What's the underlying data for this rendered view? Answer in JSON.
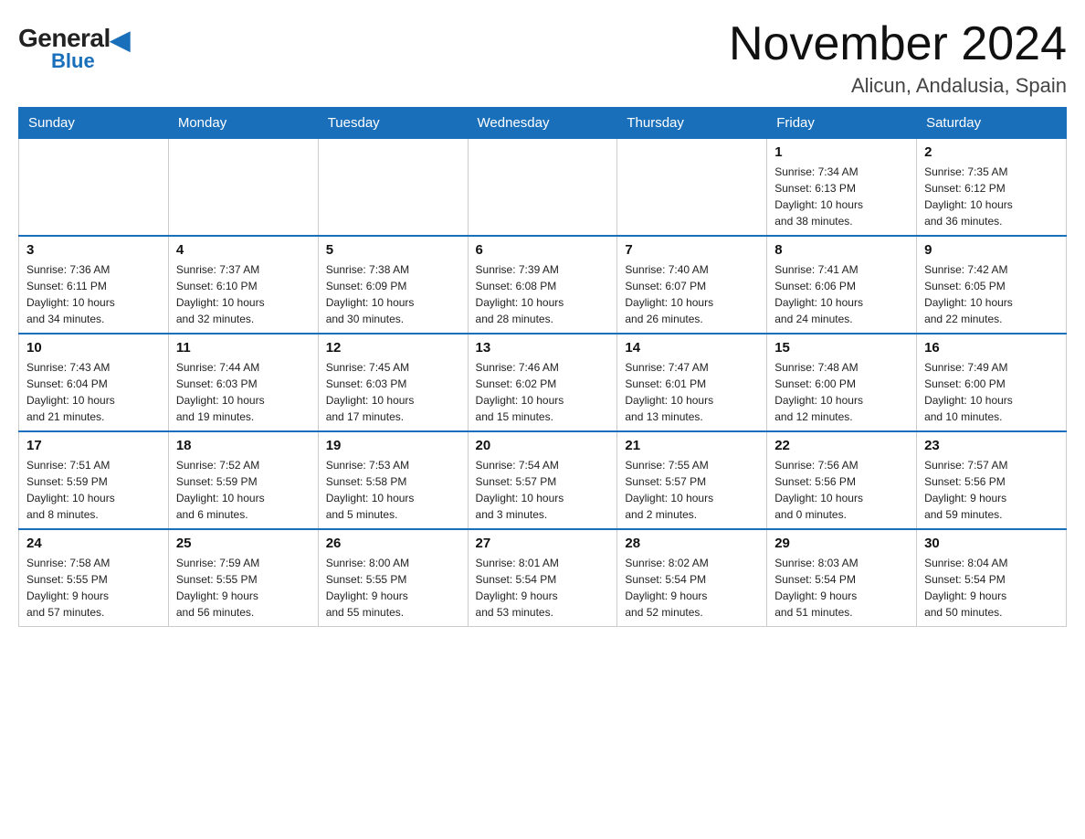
{
  "header": {
    "logo_general": "General",
    "logo_blue": "Blue",
    "month_title": "November 2024",
    "location": "Alicun, Andalusia, Spain"
  },
  "days_of_week": [
    "Sunday",
    "Monday",
    "Tuesday",
    "Wednesday",
    "Thursday",
    "Friday",
    "Saturday"
  ],
  "weeks": [
    {
      "days": [
        {
          "num": "",
          "info": ""
        },
        {
          "num": "",
          "info": ""
        },
        {
          "num": "",
          "info": ""
        },
        {
          "num": "",
          "info": ""
        },
        {
          "num": "",
          "info": ""
        },
        {
          "num": "1",
          "info": "Sunrise: 7:34 AM\nSunset: 6:13 PM\nDaylight: 10 hours\nand 38 minutes."
        },
        {
          "num": "2",
          "info": "Sunrise: 7:35 AM\nSunset: 6:12 PM\nDaylight: 10 hours\nand 36 minutes."
        }
      ]
    },
    {
      "days": [
        {
          "num": "3",
          "info": "Sunrise: 7:36 AM\nSunset: 6:11 PM\nDaylight: 10 hours\nand 34 minutes."
        },
        {
          "num": "4",
          "info": "Sunrise: 7:37 AM\nSunset: 6:10 PM\nDaylight: 10 hours\nand 32 minutes."
        },
        {
          "num": "5",
          "info": "Sunrise: 7:38 AM\nSunset: 6:09 PM\nDaylight: 10 hours\nand 30 minutes."
        },
        {
          "num": "6",
          "info": "Sunrise: 7:39 AM\nSunset: 6:08 PM\nDaylight: 10 hours\nand 28 minutes."
        },
        {
          "num": "7",
          "info": "Sunrise: 7:40 AM\nSunset: 6:07 PM\nDaylight: 10 hours\nand 26 minutes."
        },
        {
          "num": "8",
          "info": "Sunrise: 7:41 AM\nSunset: 6:06 PM\nDaylight: 10 hours\nand 24 minutes."
        },
        {
          "num": "9",
          "info": "Sunrise: 7:42 AM\nSunset: 6:05 PM\nDaylight: 10 hours\nand 22 minutes."
        }
      ]
    },
    {
      "days": [
        {
          "num": "10",
          "info": "Sunrise: 7:43 AM\nSunset: 6:04 PM\nDaylight: 10 hours\nand 21 minutes."
        },
        {
          "num": "11",
          "info": "Sunrise: 7:44 AM\nSunset: 6:03 PM\nDaylight: 10 hours\nand 19 minutes."
        },
        {
          "num": "12",
          "info": "Sunrise: 7:45 AM\nSunset: 6:03 PM\nDaylight: 10 hours\nand 17 minutes."
        },
        {
          "num": "13",
          "info": "Sunrise: 7:46 AM\nSunset: 6:02 PM\nDaylight: 10 hours\nand 15 minutes."
        },
        {
          "num": "14",
          "info": "Sunrise: 7:47 AM\nSunset: 6:01 PM\nDaylight: 10 hours\nand 13 minutes."
        },
        {
          "num": "15",
          "info": "Sunrise: 7:48 AM\nSunset: 6:00 PM\nDaylight: 10 hours\nand 12 minutes."
        },
        {
          "num": "16",
          "info": "Sunrise: 7:49 AM\nSunset: 6:00 PM\nDaylight: 10 hours\nand 10 minutes."
        }
      ]
    },
    {
      "days": [
        {
          "num": "17",
          "info": "Sunrise: 7:51 AM\nSunset: 5:59 PM\nDaylight: 10 hours\nand 8 minutes."
        },
        {
          "num": "18",
          "info": "Sunrise: 7:52 AM\nSunset: 5:59 PM\nDaylight: 10 hours\nand 6 minutes."
        },
        {
          "num": "19",
          "info": "Sunrise: 7:53 AM\nSunset: 5:58 PM\nDaylight: 10 hours\nand 5 minutes."
        },
        {
          "num": "20",
          "info": "Sunrise: 7:54 AM\nSunset: 5:57 PM\nDaylight: 10 hours\nand 3 minutes."
        },
        {
          "num": "21",
          "info": "Sunrise: 7:55 AM\nSunset: 5:57 PM\nDaylight: 10 hours\nand 2 minutes."
        },
        {
          "num": "22",
          "info": "Sunrise: 7:56 AM\nSunset: 5:56 PM\nDaylight: 10 hours\nand 0 minutes."
        },
        {
          "num": "23",
          "info": "Sunrise: 7:57 AM\nSunset: 5:56 PM\nDaylight: 9 hours\nand 59 minutes."
        }
      ]
    },
    {
      "days": [
        {
          "num": "24",
          "info": "Sunrise: 7:58 AM\nSunset: 5:55 PM\nDaylight: 9 hours\nand 57 minutes."
        },
        {
          "num": "25",
          "info": "Sunrise: 7:59 AM\nSunset: 5:55 PM\nDaylight: 9 hours\nand 56 minutes."
        },
        {
          "num": "26",
          "info": "Sunrise: 8:00 AM\nSunset: 5:55 PM\nDaylight: 9 hours\nand 55 minutes."
        },
        {
          "num": "27",
          "info": "Sunrise: 8:01 AM\nSunset: 5:54 PM\nDaylight: 9 hours\nand 53 minutes."
        },
        {
          "num": "28",
          "info": "Sunrise: 8:02 AM\nSunset: 5:54 PM\nDaylight: 9 hours\nand 52 minutes."
        },
        {
          "num": "29",
          "info": "Sunrise: 8:03 AM\nSunset: 5:54 PM\nDaylight: 9 hours\nand 51 minutes."
        },
        {
          "num": "30",
          "info": "Sunrise: 8:04 AM\nSunset: 5:54 PM\nDaylight: 9 hours\nand 50 minutes."
        }
      ]
    }
  ]
}
